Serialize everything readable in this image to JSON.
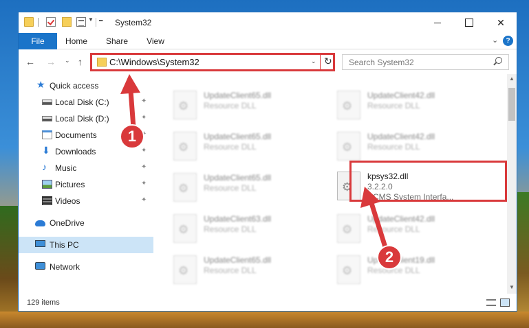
{
  "window": {
    "title": "System32",
    "minimize_icon": "minimize-icon",
    "maximize_icon": "maximize-icon",
    "close_label": "✕"
  },
  "ribbon": {
    "tabs": [
      "File",
      "Home",
      "Share",
      "View"
    ],
    "chevron": "⌄",
    "help": "?"
  },
  "address_bar": {
    "path": "C:\\Windows\\System32",
    "dropdown": "⌄",
    "refresh": "↻"
  },
  "nav": {
    "back": "←",
    "forward": "→",
    "recent": "⌄",
    "up": "↑"
  },
  "search": {
    "placeholder": "Search System32"
  },
  "sidebar": {
    "items": [
      {
        "label": "Quick access",
        "icon": "star-icon"
      },
      {
        "label": "Local Disk (C:)",
        "icon": "drive-icon",
        "pinned": true
      },
      {
        "label": "Local Disk (D:)",
        "icon": "drive-icon",
        "pinned": true
      },
      {
        "label": "Documents",
        "icon": "documents-icon",
        "pinned": true
      },
      {
        "label": "Downloads",
        "icon": "download-icon",
        "pinned": true
      },
      {
        "label": "Music",
        "icon": "music-icon",
        "pinned": true
      },
      {
        "label": "Pictures",
        "icon": "pictures-icon",
        "pinned": true
      },
      {
        "label": "Videos",
        "icon": "video-icon",
        "pinned": true
      },
      {
        "label": "OneDrive",
        "icon": "cloud-icon"
      },
      {
        "label": "This PC",
        "icon": "computer-icon",
        "selected": true
      },
      {
        "label": "Network",
        "icon": "network-icon"
      }
    ],
    "pin_glyph": "📌"
  },
  "files": {
    "blurred": [
      {
        "name": "UpdateClient65.dll",
        "type": "Resource DLL"
      },
      {
        "name": "UpdateClient42.dll",
        "type": "Resource DLL"
      },
      {
        "name": "UpdateClient65.dll",
        "type": "Resource DLL"
      },
      {
        "name": "UpdateClient42.dll",
        "type": "Resource DLL"
      },
      {
        "name": "UpdateClient65.dll",
        "type": "Resource DLL"
      },
      {
        "name": "UpdateClient63.dll",
        "type": "Resource DLL"
      },
      {
        "name": "UpdateClient42.dll",
        "type": "Resource DLL"
      },
      {
        "name": "UpdateClient65.dll",
        "type": "Resource DLL"
      },
      {
        "name": "UpdateClient19.dll",
        "type": "Resource DLL"
      }
    ],
    "highlighted": {
      "name": "kpsys32.dll",
      "version": "3.2.2.0",
      "description": "KCMS System Interfa..."
    }
  },
  "status": {
    "item_count": "129 items"
  },
  "callouts": {
    "step1": "1",
    "step2": "2",
    "color": "#d9393b"
  }
}
